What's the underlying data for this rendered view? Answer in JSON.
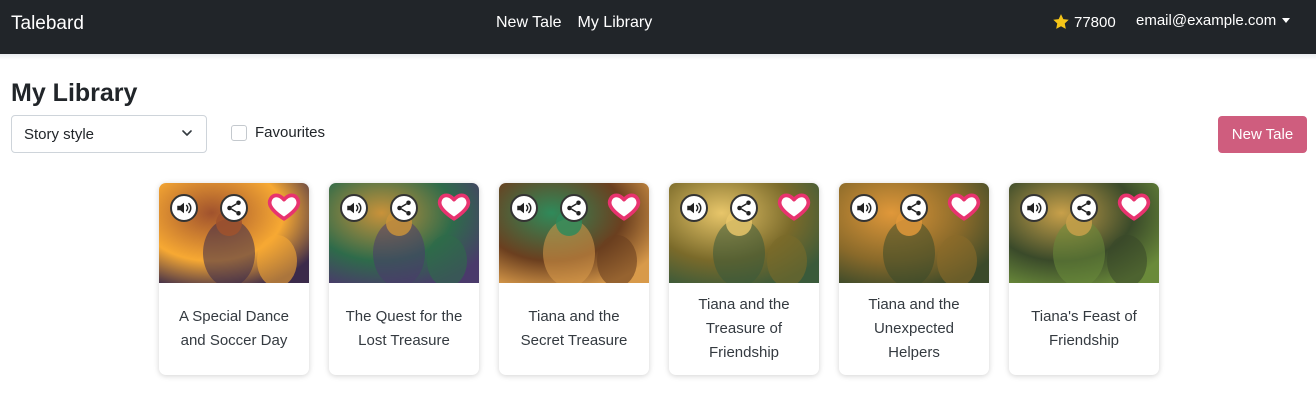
{
  "navbar": {
    "brand": "Talebard",
    "links": [
      "New Tale",
      "My Library"
    ],
    "credits": "77800",
    "credits_icon": "star-icon",
    "user_email": "email@example.com"
  },
  "page": {
    "title": "My Library",
    "style_select": {
      "selected": "Story style"
    },
    "favourites_label": "Favourites",
    "favourites_checked": false,
    "new_tale_label": "New Tale"
  },
  "colors": {
    "navbar_bg": "#212529",
    "accent": "#cf5d7e",
    "heart": "#e8336f",
    "star": "#f5c518"
  },
  "cards": [
    {
      "title": "A Special Dance and Soccer Day",
      "palette": [
        "#f7a933",
        "#a0522d",
        "#3b2a4a"
      ]
    },
    {
      "title": "The Quest for the Lost Treasure",
      "palette": [
        "#2e6b4a",
        "#c9923a",
        "#4a3a6b"
      ]
    },
    {
      "title": "Tiana and the Secret Treasure",
      "palette": [
        "#6b3f1f",
        "#2f8a5a",
        "#d89a4a"
      ]
    },
    {
      "title": "Tiana and the Treasure of Friendship",
      "palette": [
        "#7a6a2a",
        "#e8c66a",
        "#3a5a3a"
      ]
    },
    {
      "title": "Tiana and the Unexpected Helpers",
      "palette": [
        "#8a6a2a",
        "#e0983a",
        "#3b4a2a"
      ]
    },
    {
      "title": "Tiana's Feast of Friendship",
      "palette": [
        "#3a4a2a",
        "#c8a04a",
        "#6a8a3a"
      ]
    }
  ]
}
